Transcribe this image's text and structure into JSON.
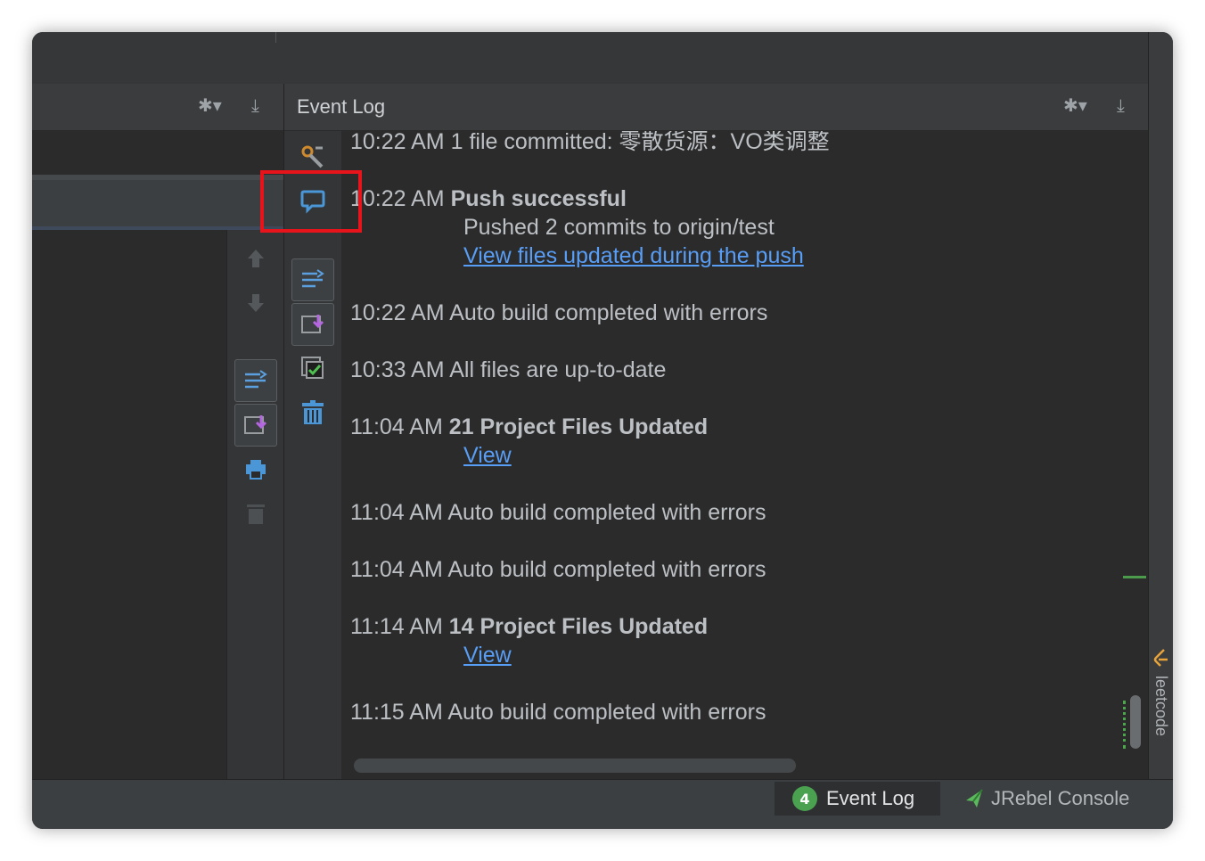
{
  "panel": {
    "title": "Event Log"
  },
  "log": {
    "entries": [
      {
        "time": "10:22 AM",
        "message": "1 file committed: 零散货源：VO类调整",
        "bold": false
      },
      {
        "time": "10:22 AM",
        "message": "Push successful",
        "bold": true,
        "detail": "Pushed 2 commits to origin/test",
        "link": "View files updated during the push"
      },
      {
        "time": "10:22 AM",
        "message": "Auto build completed with errors",
        "bold": false
      },
      {
        "time": "10:33 AM",
        "message": "All files are up-to-date",
        "bold": false
      },
      {
        "time": "11:04 AM",
        "message": "21 Project Files Updated",
        "bold": true,
        "link": "View"
      },
      {
        "time": "11:04 AM",
        "message": "Auto build completed with errors",
        "bold": false
      },
      {
        "time": "11:04 AM",
        "message": "Auto build completed with errors",
        "bold": false
      },
      {
        "time": "11:14 AM",
        "message": "14 Project Files Updated",
        "bold": true,
        "link": "View"
      },
      {
        "time": "11:15 AM",
        "message": "Auto build completed with errors",
        "bold": false
      }
    ]
  },
  "bottom_tabs": {
    "event_log": {
      "label": "Event Log",
      "count": "4"
    },
    "jrebel": {
      "label": "JRebel Console"
    }
  },
  "side_plugin": {
    "label": "leetcode"
  },
  "icons": {
    "settings": "gear-icon",
    "hide": "hide-panel-icon",
    "wrench": "wrench-icon",
    "balloon": "balloon-icon",
    "diff": "diff-icon",
    "pull": "update-icon",
    "checkbox": "checkbox-icon",
    "trash": "trash-icon",
    "up": "arrow-up-icon",
    "down": "arrow-down-icon",
    "print": "print-icon"
  },
  "colors": {
    "background": "#2b2b2b",
    "link": "#589df6",
    "highlight": "#e8141b",
    "badge": "#4aa150"
  }
}
